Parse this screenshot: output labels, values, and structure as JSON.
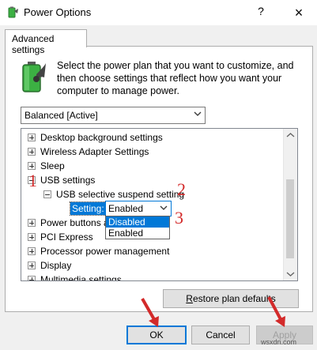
{
  "window": {
    "title": "Power Options",
    "help_symbol": "?",
    "close_symbol": "×"
  },
  "tab": {
    "label": "Advanced settings"
  },
  "description": {
    "line1": "Select the power plan that you want to customize, and",
    "line2": "then choose settings that reflect how you want your",
    "line3": "computer to manage power."
  },
  "plan_select": {
    "value": "Balanced [Active]"
  },
  "tree": {
    "items": [
      {
        "label": "Desktop background settings",
        "state": "collapsed"
      },
      {
        "label": "Wireless Adapter Settings",
        "state": "collapsed"
      },
      {
        "label": "Sleep",
        "state": "collapsed"
      },
      {
        "label": "USB settings",
        "state": "expanded"
      },
      {
        "label": "USB selective suspend setting",
        "state": "expanded"
      },
      {
        "label": "Power buttons a",
        "state": "collapsed"
      },
      {
        "label": "PCI Express",
        "state": "collapsed"
      },
      {
        "label": "Processor power management",
        "state": "collapsed"
      },
      {
        "label": "Display",
        "state": "collapsed"
      },
      {
        "label": "Multimedia settings",
        "state": "collapsed"
      }
    ],
    "setting_label": "Setting:",
    "setting_value": "Enabled",
    "options": [
      "Disabled",
      "Enabled"
    ],
    "highlighted_option": "Disabled"
  },
  "annotations": {
    "one": "1",
    "two": "2",
    "three": "3"
  },
  "buttons": {
    "restore_prefix": "",
    "restore_underline": "R",
    "restore_rest": "estore plan defaults",
    "ok": "OK",
    "cancel": "Cancel",
    "apply": "Apply"
  },
  "watermark": "wsxdn.com",
  "colors": {
    "accent": "#0078d7",
    "annotation_red": "#d32a2a",
    "battery_green": "#3cb043"
  }
}
